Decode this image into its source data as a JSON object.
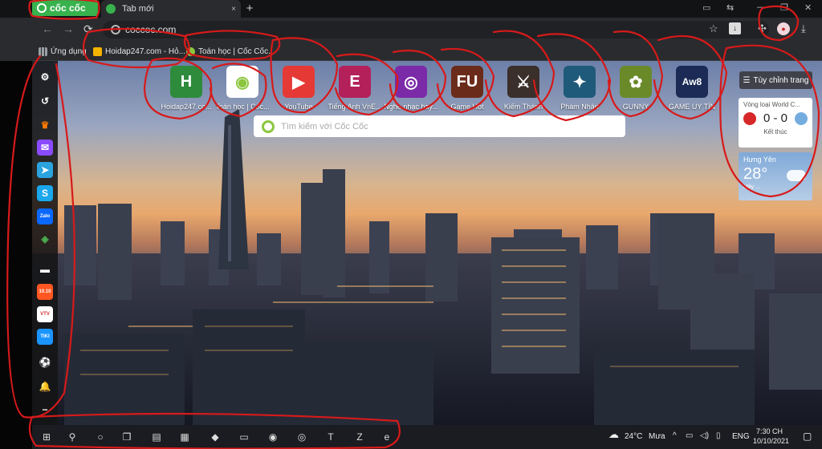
{
  "tabstrip": {
    "brand": "cốc cốc",
    "tab_title": "Tab mới",
    "new_tab": "+",
    "close": "×"
  },
  "toolbar": {
    "back": "←",
    "forward": "→",
    "reload": "⟳",
    "url": "coccoc.com",
    "icons": [
      "star-icon",
      "download-badge-icon",
      "extensions-icon",
      "profile-icon",
      "downloads-icon"
    ]
  },
  "bookmarks": [
    {
      "label": "Ứng dụng",
      "icon": "apps-grid-icon",
      "color": "#9aa0a6"
    },
    {
      "label": "Hoidap247.com - Hỏ...",
      "icon": "hoidap-icon",
      "color": "#f4b400"
    },
    {
      "label": "Toán học | Cốc Cốc...",
      "icon": "coccoc-icon",
      "color": "#8cc63f"
    }
  ],
  "tiles": [
    {
      "label": "Hoidap247.co...",
      "glyph": "H",
      "bg": "#2e8b3c"
    },
    {
      "label": "Toán học | Cốc...",
      "glyph": "◉",
      "bg": "#ffffff"
    },
    {
      "label": "YouTube",
      "glyph": "▶",
      "bg": "#e53935"
    },
    {
      "label": "Tiếng Anh VnE...",
      "glyph": "E",
      "bg": "#b3205a"
    },
    {
      "label": "Nghe nhạc hay...",
      "glyph": "◎",
      "bg": "#7b2aa8"
    },
    {
      "label": "Game Hot",
      "glyph": "FU",
      "bg": "#6b2b1a"
    },
    {
      "label": "Kiếm Thánh",
      "glyph": "⚔",
      "bg": "#3a2f2a"
    },
    {
      "label": "Phàm Nhân",
      "glyph": "✦",
      "bg": "#1f5a7a"
    },
    {
      "label": "GUNNY",
      "glyph": "✿",
      "bg": "#6a8a2a"
    },
    {
      "label": "GAME UY TÍN",
      "glyph": "Aw8",
      "bg": "#1b2b55"
    }
  ],
  "search": {
    "placeholder": "Tìm kiếm với Cốc Cốc"
  },
  "customize": {
    "label": "Tùy chỉnh trang"
  },
  "sports": {
    "title": "Vòng loại World C...",
    "score": "0 - 0",
    "status": "Kết thúc",
    "team1_color": "#d62828",
    "team2_color": "#74acdf"
  },
  "weather": {
    "location": "Hưng Yên",
    "temp": "28°",
    "desc": "Mây ..."
  },
  "sidebar": [
    {
      "name": "settings-icon",
      "glyph": "⚙",
      "bg": "transparent"
    },
    {
      "name": "history-icon",
      "glyph": "↺",
      "bg": "transparent"
    },
    {
      "name": "crown-icon",
      "glyph": "♛",
      "bg": "transparent",
      "color": "#ff7a00"
    },
    {
      "name": "messenger-icon",
      "glyph": "✉",
      "bg": "#8a4bff"
    },
    {
      "name": "telegram-icon",
      "glyph": "➤",
      "bg": "#2aa3de"
    },
    {
      "name": "skype-icon",
      "glyph": "S",
      "bg": "#1aa7ec"
    },
    {
      "name": "zalo-icon",
      "glyph": "Zalo",
      "bg": "#0a68ff"
    },
    {
      "name": "gamepad-icon",
      "glyph": "◈",
      "bg": "transparent",
      "color": "#4caf50"
    },
    {
      "name": "divider-icon",
      "glyph": "▬",
      "bg": "transparent"
    },
    {
      "name": "shopping-icon",
      "glyph": "10.10",
      "bg": "#ff5722"
    },
    {
      "name": "vtv-icon",
      "glyph": "VTV",
      "bg": "#ffffff",
      "color": "#d32f2f"
    },
    {
      "name": "tiki-icon",
      "glyph": "TIKI",
      "bg": "#1a94ff"
    },
    {
      "name": "football-icon",
      "glyph": "⚽",
      "bg": "transparent"
    },
    {
      "name": "bell-icon",
      "glyph": "🔔",
      "bg": "transparent"
    },
    {
      "name": "more-icon",
      "glyph": "•••",
      "bg": "transparent"
    }
  ],
  "taskbar": {
    "apps": [
      {
        "name": "windows-start-icon",
        "glyph": "⊞"
      },
      {
        "name": "search-icon",
        "glyph": "⚲"
      },
      {
        "name": "cortana-icon",
        "glyph": "○"
      },
      {
        "name": "task-view-icon",
        "glyph": "❒"
      },
      {
        "name": "app-pinned-1-icon",
        "glyph": "▤"
      },
      {
        "name": "calculator-icon",
        "glyph": "▦"
      },
      {
        "name": "app-pinned-2-icon",
        "glyph": "◆"
      },
      {
        "name": "file-explorer-icon",
        "glyph": "▭"
      },
      {
        "name": "chrome-icon",
        "glyph": "◉"
      },
      {
        "name": "coccoc-taskbar-icon",
        "glyph": "◎"
      },
      {
        "name": "teams-icon",
        "glyph": "T"
      },
      {
        "name": "zalo-taskbar-icon",
        "glyph": "Z"
      },
      {
        "name": "edge-icon",
        "glyph": "e"
      }
    ],
    "weather_temp": "24°C",
    "weather_desc": "Mưa",
    "lang": "ENG",
    "time": "7:30 CH",
    "date": "10/10/2021"
  }
}
